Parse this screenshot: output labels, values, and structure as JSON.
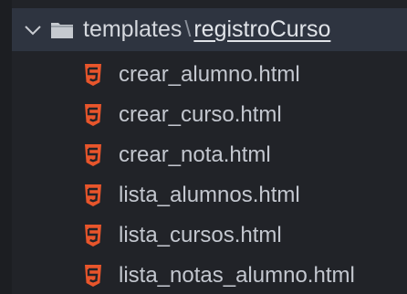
{
  "explorer": {
    "folder": {
      "parent": "templates",
      "separator": "\\",
      "current": "registroCurso",
      "expanded": true
    },
    "files": [
      {
        "name": "crear_alumno.html",
        "icon": "html5-icon"
      },
      {
        "name": "crear_curso.html",
        "icon": "html5-icon"
      },
      {
        "name": "crear_nota.html",
        "icon": "html5-icon"
      },
      {
        "name": "lista_alumnos.html",
        "icon": "html5-icon"
      },
      {
        "name": "lista_cursos.html",
        "icon": "html5-icon"
      },
      {
        "name": "lista_notas_alumno.html",
        "icon": "html5-icon"
      }
    ]
  },
  "colors": {
    "background": "#212328",
    "folder_row": "#2e3440",
    "html_icon": "#e8552b",
    "text": "#c3c7cf"
  }
}
